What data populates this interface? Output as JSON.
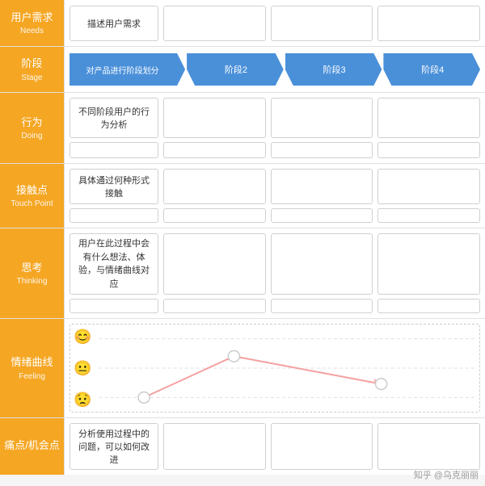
{
  "rows": [
    {
      "id": "needs",
      "label_zh": "用户需求",
      "label_en": "Needs",
      "text_content": "描述用户需求"
    },
    {
      "id": "stage",
      "label_zh": "阶段",
      "label_en": "Stage",
      "stages": [
        "对产品进行阶段划分",
        "阶段2",
        "阶段3",
        "阶段4"
      ]
    },
    {
      "id": "doing",
      "label_zh": "行为",
      "label_en": "Doing",
      "text_content": "不同阶段用户的行为分析"
    },
    {
      "id": "touchpoint",
      "label_zh": "接触点",
      "label_en": "Touch Point",
      "text_content": "具体通过何种形式接触"
    },
    {
      "id": "thinking",
      "label_zh": "思考",
      "label_en": "Thinking",
      "text_content": "用户在此过程中会有什么想法、体验，与情绪曲线对应"
    },
    {
      "id": "feeling",
      "label_zh": "情绪曲线",
      "label_en": "Feeling",
      "emojis": [
        "😊",
        "😐",
        "😟"
      ]
    },
    {
      "id": "pain",
      "label_zh": "痛点/机会点",
      "label_en": "",
      "text_content": "分析使用过程中的问题，可以如何改进"
    }
  ],
  "watermark": "知乎 @乌克丽丽"
}
